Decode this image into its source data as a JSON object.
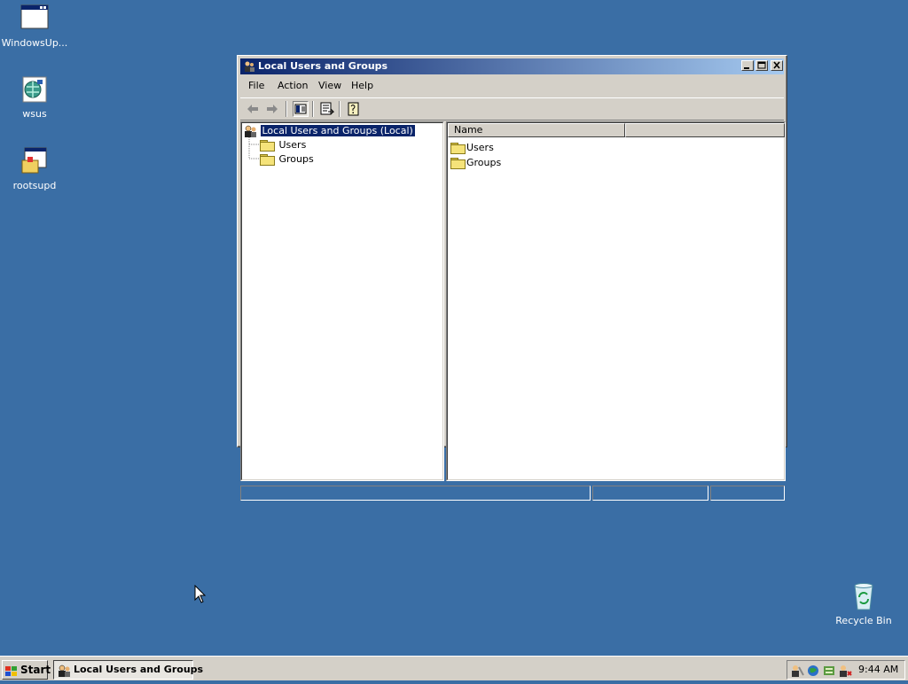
{
  "desktop": {
    "icons": [
      {
        "label": "WindowsUp...",
        "icon": "window-icon"
      },
      {
        "label": "wsus",
        "icon": "network-globe-icon"
      },
      {
        "label": "rootsupd",
        "icon": "installer-icon"
      },
      {
        "label": "Recycle Bin",
        "icon": "recycle-bin-icon"
      }
    ]
  },
  "window": {
    "title": "Local Users and Groups",
    "menu": [
      "File",
      "Action",
      "View",
      "Help"
    ],
    "toolbar": [
      "back-arrow-icon",
      "forward-arrow-icon",
      "show-hide-tree-icon",
      "export-list-icon",
      "help-icon"
    ],
    "tree": {
      "root": "Local Users and Groups (Local)",
      "children": [
        "Users",
        "Groups"
      ]
    },
    "list": {
      "columns": [
        "Name",
        ""
      ],
      "items": [
        "Users",
        "Groups"
      ]
    }
  },
  "taskbar": {
    "start_label": "Start",
    "tasks": [
      "Local Users and Groups"
    ],
    "tray_icons": [
      "admin-tools-icon",
      "network-icon",
      "update-icon",
      "security-icon"
    ],
    "clock": "9:44 AM"
  },
  "colors": {
    "desktop": "#3a6ea5",
    "title_start": "#0a246a",
    "title_end": "#a6caf0",
    "face": "#d4d0c8"
  }
}
